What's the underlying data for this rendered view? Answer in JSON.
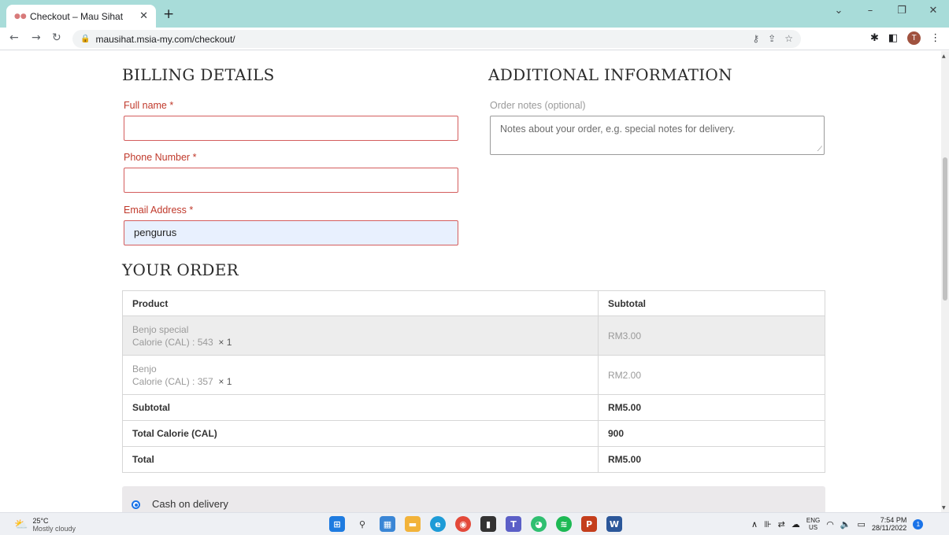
{
  "browser": {
    "tab_title": "Checkout – Mau Sihat",
    "url": "mausihat.msia-my.com/checkout/",
    "profile_initial": "T"
  },
  "billing": {
    "heading": "BILLING DETAILS",
    "full_name_label": "Full name",
    "full_name_value": "",
    "phone_label": "Phone Number",
    "phone_value": "",
    "email_label": "Email Address",
    "email_value": "pengurus",
    "required_mark": "*"
  },
  "additional": {
    "heading": "ADDITIONAL INFORMATION",
    "notes_label": "Order notes (optional)",
    "notes_placeholder": "Notes about your order, e.g. special notes for delivery."
  },
  "order": {
    "heading": "YOUR ORDER",
    "columns": [
      "Product",
      "Subtotal"
    ],
    "items": [
      {
        "name": "Benjo special",
        "calorie_label": "Calorie (CAL) : 543",
        "qty": "× 1",
        "subtotal": "RM3.00"
      },
      {
        "name": "Benjo",
        "calorie_label": "Calorie (CAL) : 357",
        "qty": "× 1",
        "subtotal": "RM2.00"
      }
    ],
    "subtotal_label": "Subtotal",
    "subtotal_value": "RM5.00",
    "total_calorie_label": "Total Calorie (CAL)",
    "total_calorie_value": "900",
    "total_label": "Total",
    "total_value": "RM5.00"
  },
  "payment": {
    "method_label": "Cash on delivery",
    "selected": true
  },
  "taskbar": {
    "temperature": "25°C",
    "weather": "Mostly cloudy",
    "lang_top": "ENG",
    "lang_bottom": "US",
    "time": "7:54 PM",
    "date": "28/11/2022",
    "notification_count": "1"
  },
  "colors": {
    "tab_strip": "#a8dcd9",
    "required_red": "#c0392b",
    "autofill_blue": "#e8f0fe",
    "radio_blue": "#1a73e8"
  }
}
